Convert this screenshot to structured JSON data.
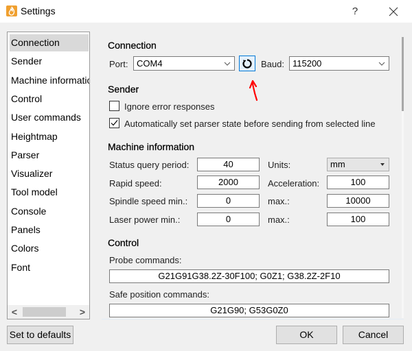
{
  "window": {
    "title": "Settings",
    "app_icon": "flame-app-icon",
    "help_label": "?",
    "close_icon": "close-icon"
  },
  "sidebar": {
    "items": [
      {
        "label": "Connection",
        "selected": true
      },
      {
        "label": "Sender"
      },
      {
        "label": "Machine information"
      },
      {
        "label": "Control"
      },
      {
        "label": "User commands"
      },
      {
        "label": "Heightmap"
      },
      {
        "label": "Parser"
      },
      {
        "label": "Visualizer"
      },
      {
        "label": "Tool model"
      },
      {
        "label": "Console"
      },
      {
        "label": "Panels"
      },
      {
        "label": "Colors"
      },
      {
        "label": "Font"
      }
    ],
    "scroll_left": "<",
    "scroll_right": ">"
  },
  "connection": {
    "title": "Connection",
    "port_label": "Port:",
    "port_value": "COM4",
    "refresh_icon": "refresh-icon",
    "baud_label": "Baud:",
    "baud_value": "115200"
  },
  "sender": {
    "title": "Sender",
    "ignore_errors_label": "Ignore error responses",
    "ignore_errors_checked": false,
    "auto_parser_label": "Automatically set parser state before sending from selected line",
    "auto_parser_checked": true
  },
  "machine": {
    "title": "Machine information",
    "status_query_label": "Status query period:",
    "status_query_value": "40",
    "units_label": "Units:",
    "units_value": "mm",
    "rapid_speed_label": "Rapid speed:",
    "rapid_speed_value": "2000",
    "acceleration_label": "Acceleration:",
    "acceleration_value": "100",
    "spindle_min_label": "Spindle speed min.:",
    "spindle_min_value": "0",
    "spindle_max_label": "max.:",
    "spindle_max_value": "10000",
    "laser_min_label": "Laser power min.:",
    "laser_min_value": "0",
    "laser_max_label": "max.:",
    "laser_max_value": "100"
  },
  "control": {
    "title": "Control",
    "probe_label": "Probe commands:",
    "probe_value": "G21G91G38.2Z-30F100; G0Z1; G38.2Z-2F10",
    "safe_label": "Safe position commands:",
    "safe_value": "G21G90; G53G0Z0"
  },
  "footer": {
    "defaults_label": "Set to defaults",
    "ok_label": "OK",
    "cancel_label": "Cancel"
  },
  "colors": {
    "accent": "#0078d7",
    "annotation": "#ff0000",
    "app_icon": "#f0a030"
  }
}
